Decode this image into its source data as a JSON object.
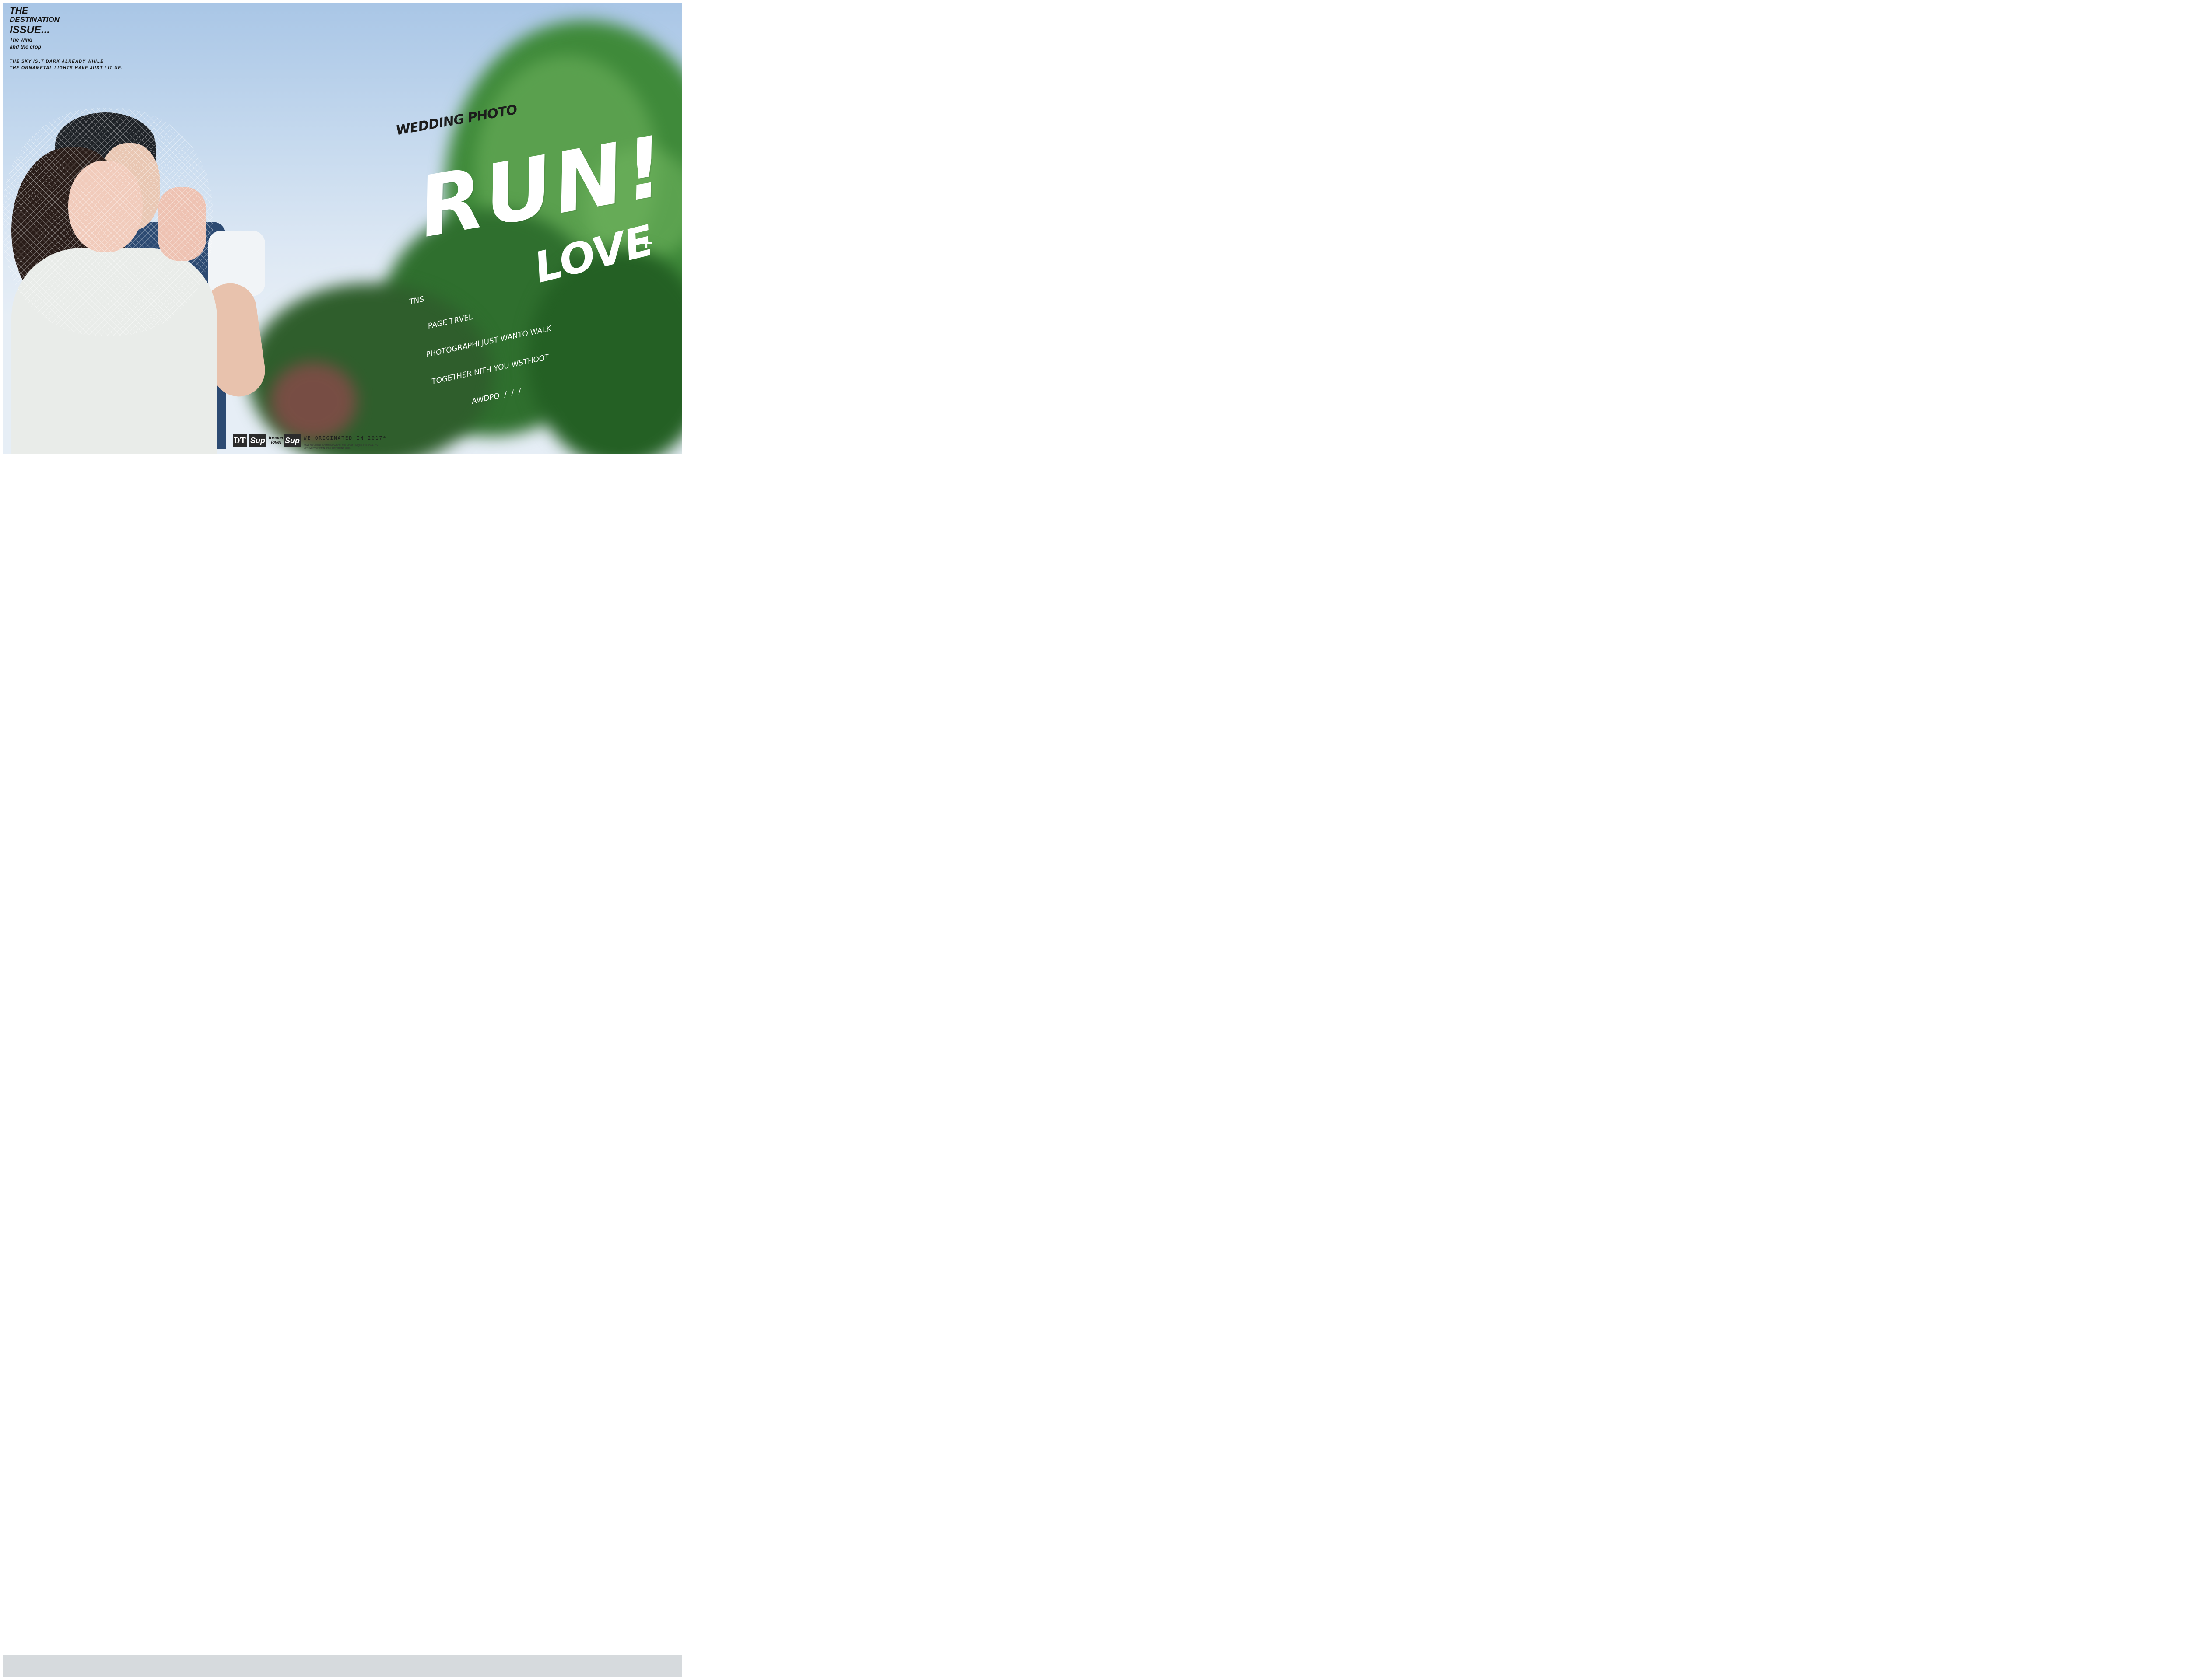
{
  "headline": {
    "line1": "THE",
    "line2": "DESTINATION",
    "line3": "ISSUE...",
    "sub1": "The wind",
    "sub2": "and the crop",
    "caption1": "THE SKY IS„T DARK ALREADY WHILE",
    "caption2": "THE ORNAMETAL LIGHTS HAVE JUST LIT UP."
  },
  "title": {
    "wedding": "WEDDING PHOTO",
    "run": "RUN!",
    "love": "LOVE",
    "plus": "+"
  },
  "paragraph": {
    "l1": "TNS",
    "l2": "PAGE TRVEL",
    "l3": "PHOTOGRAPHI JUST WANTO WALK",
    "l4": "TOGETHER NITH YOU WSTHOOT",
    "l5": "AWDPO  /  /  /"
  },
  "footer": {
    "logo_dt": "DT",
    "logo_sup1": "Sup",
    "logo_forever_1": "forever",
    "logo_forever_2": "love!",
    "logo_sup2": "Sup",
    "main": "WE ORIGINATED IN 2017*",
    "sub1": "STAR OF VISUAL COMMUNICATION. THE MOST UNIQUE PERSONALITY.",
    "sub2": "LET EVERY WOMAN HAVE DIFFERENT SIDE."
  },
  "colors": {
    "sky_top": "#a9c6e6",
    "foliage": "#3f8a3a",
    "text_dark": "#141414",
    "text_light": "#ffffff"
  }
}
